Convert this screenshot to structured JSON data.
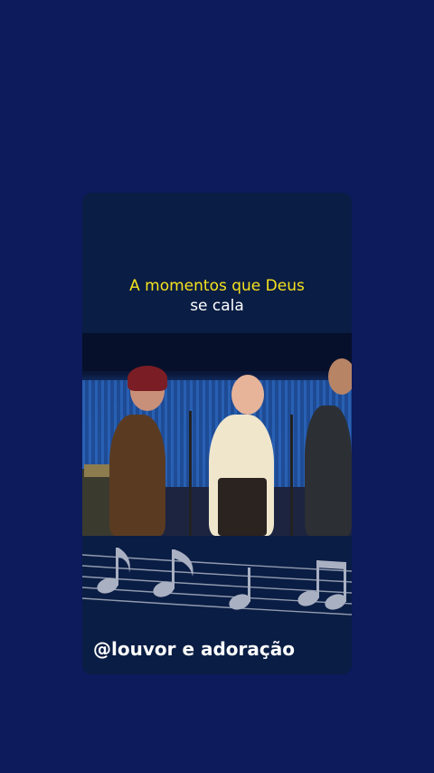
{
  "caption": {
    "line1": "A momentos que Deus",
    "line2": "se cala"
  },
  "handle": "@louvor e adoração",
  "colors": {
    "background": "#0d1a5c",
    "card": "#0a1d44",
    "caption_accent": "#f5e21c",
    "notes": "#a9b0c2"
  },
  "icons": [
    "music-notes-icon"
  ]
}
